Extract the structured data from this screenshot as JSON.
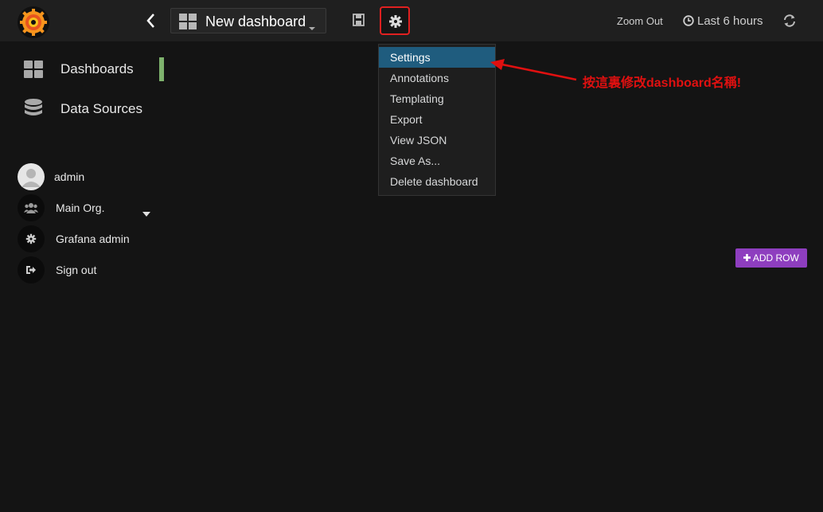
{
  "topbar": {
    "dashboard_title": "New dashboard",
    "zoom_out_label": "Zoom Out",
    "time_range_label": "Last 6 hours"
  },
  "sidemenu": {
    "items": [
      {
        "label": "Dashboards",
        "icon": "grid-icon",
        "active": true
      },
      {
        "label": "Data Sources",
        "icon": "database-icon"
      }
    ],
    "user": {
      "name": "admin",
      "org": "Main Org.",
      "grafana_admin": "Grafana admin",
      "sign_out": "Sign out"
    }
  },
  "settings_menu": {
    "items": [
      {
        "label": "Settings",
        "active": true
      },
      {
        "label": "Annotations"
      },
      {
        "label": "Templating"
      },
      {
        "label": "Export"
      },
      {
        "label": "View JSON"
      },
      {
        "label": "Save As..."
      },
      {
        "label": "Delete dashboard"
      }
    ]
  },
  "annotation": {
    "text": "按這裏修改dashboard名稱!",
    "color": "#e01010"
  },
  "main": {
    "add_row_label": "ADD ROW"
  },
  "colors": {
    "accent_active": "#7eb26d",
    "add_row_bg": "#8e3ebf",
    "menu_active_bg": "#1f5c7e",
    "highlight_border": "#e02020"
  }
}
